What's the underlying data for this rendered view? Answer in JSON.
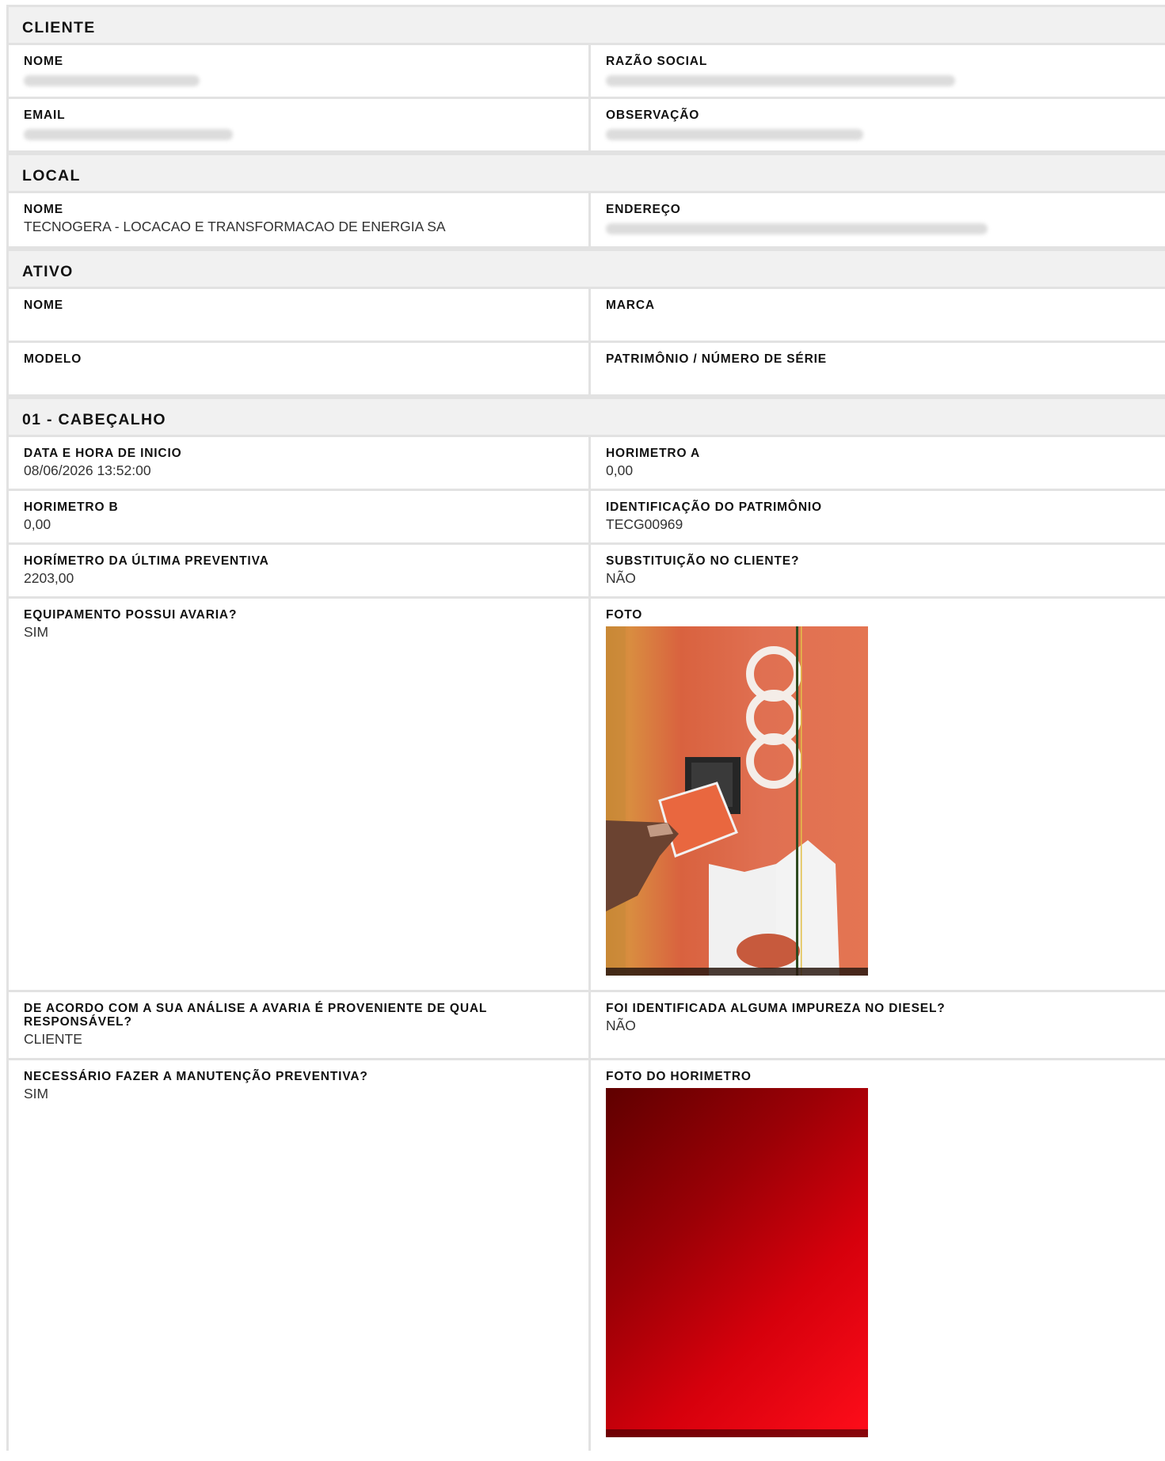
{
  "cliente": {
    "title": "CLIENTE",
    "nome_label": "NOME",
    "razao_label": "RAZÃO SOCIAL",
    "email_label": "EMAIL",
    "obs_label": "OBSERVAÇÃO"
  },
  "local": {
    "title": "LOCAL",
    "nome_label": "NOME",
    "nome_value": "TECNOGERA - LOCACAO E TRANSFORMACAO DE ENERGIA SA",
    "endereco_label": "ENDEREÇO"
  },
  "ativo": {
    "title": "ATIVO",
    "nome_label": "NOME",
    "marca_label": "MARCA",
    "modelo_label": "MODELO",
    "patrimonio_label": "PATRIMÔNIO / NÚMERO DE SÉRIE"
  },
  "cabecalho": {
    "title": "01 - CABEÇALHO",
    "data_label": "DATA E HORA DE INICIO",
    "data_value": "08/06/2026 13:52:00",
    "horimetro_a_label": "HORIMETRO A",
    "horimetro_a_value": "0,00",
    "horimetro_b_label": "HORIMETRO B",
    "horimetro_b_value": "0,00",
    "identificacao_label": "IDENTIFICAÇÃO DO PATRIMÔNIO",
    "identificacao_value": "TECG00969",
    "ultima_prev_label": "HORÍMETRO DA ÚLTIMA PREVENTIVA",
    "ultima_prev_value": "2203,00",
    "substituicao_label": "SUBSTITUIÇÃO NO CLIENTE?",
    "substituicao_value": "NÃO",
    "avaria_label": "EQUIPAMENTO POSSUI AVARIA?",
    "avaria_value": "SIM",
    "foto_label": "FOTO",
    "responsavel_label": "DE ACORDO COM A SUA ANÁLISE A AVARIA É PROVENIENTE DE QUAL RESPONSÁVEL?",
    "responsavel_value": "CLIENTE",
    "impureza_label": "FOI IDENTIFICADA ALGUMA IMPUREZA NO DIESEL?",
    "impureza_value": "NÃO",
    "preventiva_label": "NECESSÁRIO FAZER A MANUTENÇÃO PREVENTIVA?",
    "preventiva_value": "SIM",
    "foto_horimetro_label": "FOTO DO HORIMETRO"
  }
}
